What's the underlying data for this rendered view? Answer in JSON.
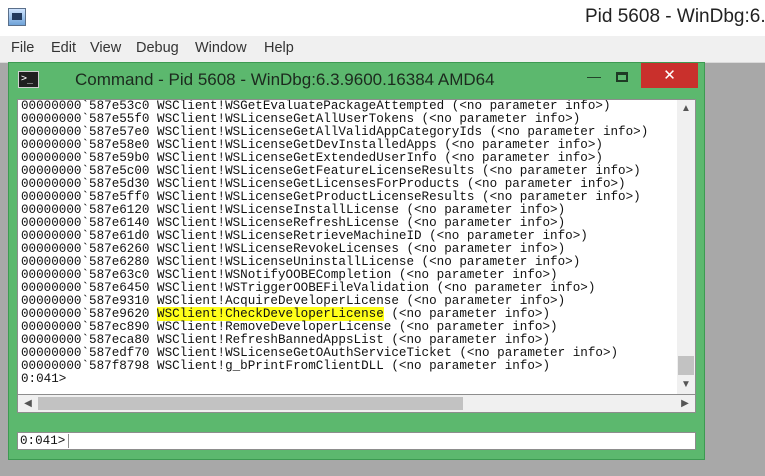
{
  "app": {
    "title": "Pid 5608 - WinDbg:6."
  },
  "menu": [
    "File",
    "Edit",
    "View",
    "Debug",
    "Window",
    "Help"
  ],
  "command_window": {
    "title": "Command - Pid 5608 - WinDbg:6.3.9600.16384 AMD64",
    "minimize_glyph": "—",
    "close_glyph": "✕"
  },
  "output": {
    "lines": [
      {
        "addr": "00000000`587e53c0",
        "text": "WSClient!WSGetEvaluatePackageAttempted (<no parameter info>)"
      },
      {
        "addr": "00000000`587e55f0",
        "text": "WSClient!WSLicenseGetAllUserTokens (<no parameter info>)"
      },
      {
        "addr": "00000000`587e57e0",
        "text": "WSClient!WSLicenseGetAllValidAppCategoryIds (<no parameter info>)"
      },
      {
        "addr": "00000000`587e58e0",
        "text": "WSClient!WSLicenseGetDevInstalledApps (<no parameter info>)"
      },
      {
        "addr": "00000000`587e59b0",
        "text": "WSClient!WSLicenseGetExtendedUserInfo (<no parameter info>)"
      },
      {
        "addr": "00000000`587e5c00",
        "text": "WSClient!WSLicenseGetFeatureLicenseResults (<no parameter info>)"
      },
      {
        "addr": "00000000`587e5d30",
        "text": "WSClient!WSLicenseGetLicensesForProducts (<no parameter info>)"
      },
      {
        "addr": "00000000`587e5ff0",
        "text": "WSClient!WSLicenseGetProductLicenseResults (<no parameter info>)"
      },
      {
        "addr": "00000000`587e6120",
        "text": "WSClient!WSLicenseInstallLicense (<no parameter info>)"
      },
      {
        "addr": "00000000`587e6140",
        "text": "WSClient!WSLicenseRefreshLicense (<no parameter info>)"
      },
      {
        "addr": "00000000`587e61d0",
        "text": "WSClient!WSLicenseRetrieveMachineID (<no parameter info>)"
      },
      {
        "addr": "00000000`587e6260",
        "text": "WSClient!WSLicenseRevokeLicenses (<no parameter info>)"
      },
      {
        "addr": "00000000`587e6280",
        "text": "WSClient!WSLicenseUninstallLicense (<no parameter info>)"
      },
      {
        "addr": "00000000`587e63c0",
        "text": "WSClient!WSNotifyOOBECompletion (<no parameter info>)"
      },
      {
        "addr": "00000000`587e6450",
        "text": "WSClient!WSTriggerOOBEFileValidation (<no parameter info>)"
      },
      {
        "addr": "00000000`587e9310",
        "text": "WSClient!AcquireDeveloperLicense (<no parameter info>)"
      },
      {
        "addr": "00000000`587e9620",
        "text": "WSClient!CheckDeveloperLicense",
        "highlight": "WSClient!CheckDeveloperLicense",
        "rest": " (<no parameter info>)"
      },
      {
        "addr": "00000000`587ec890",
        "text": "WSClient!RemoveDeveloperLicense (<no parameter info>)"
      },
      {
        "addr": "00000000`587eca80",
        "text": "WSClient!RefreshBannedAppsList (<no parameter info>)"
      },
      {
        "addr": "00000000`587edf70",
        "text": "WSClient!WSLicenseGetOAuthServiceTicket (<no parameter info>)"
      },
      {
        "addr": "00000000`587f8798",
        "text": "WSClient!g_bPrintFromClientDLL (<no parameter info>)"
      }
    ],
    "prompt_line": "0:041>"
  },
  "input": {
    "prompt": "0:041>",
    "value": ""
  },
  "colors": {
    "window_frame": "#5cb86e",
    "close_button": "#c9302c",
    "highlight": "#ffff1a"
  },
  "icons": {
    "app": "windbg-icon",
    "command": "console-icon"
  }
}
